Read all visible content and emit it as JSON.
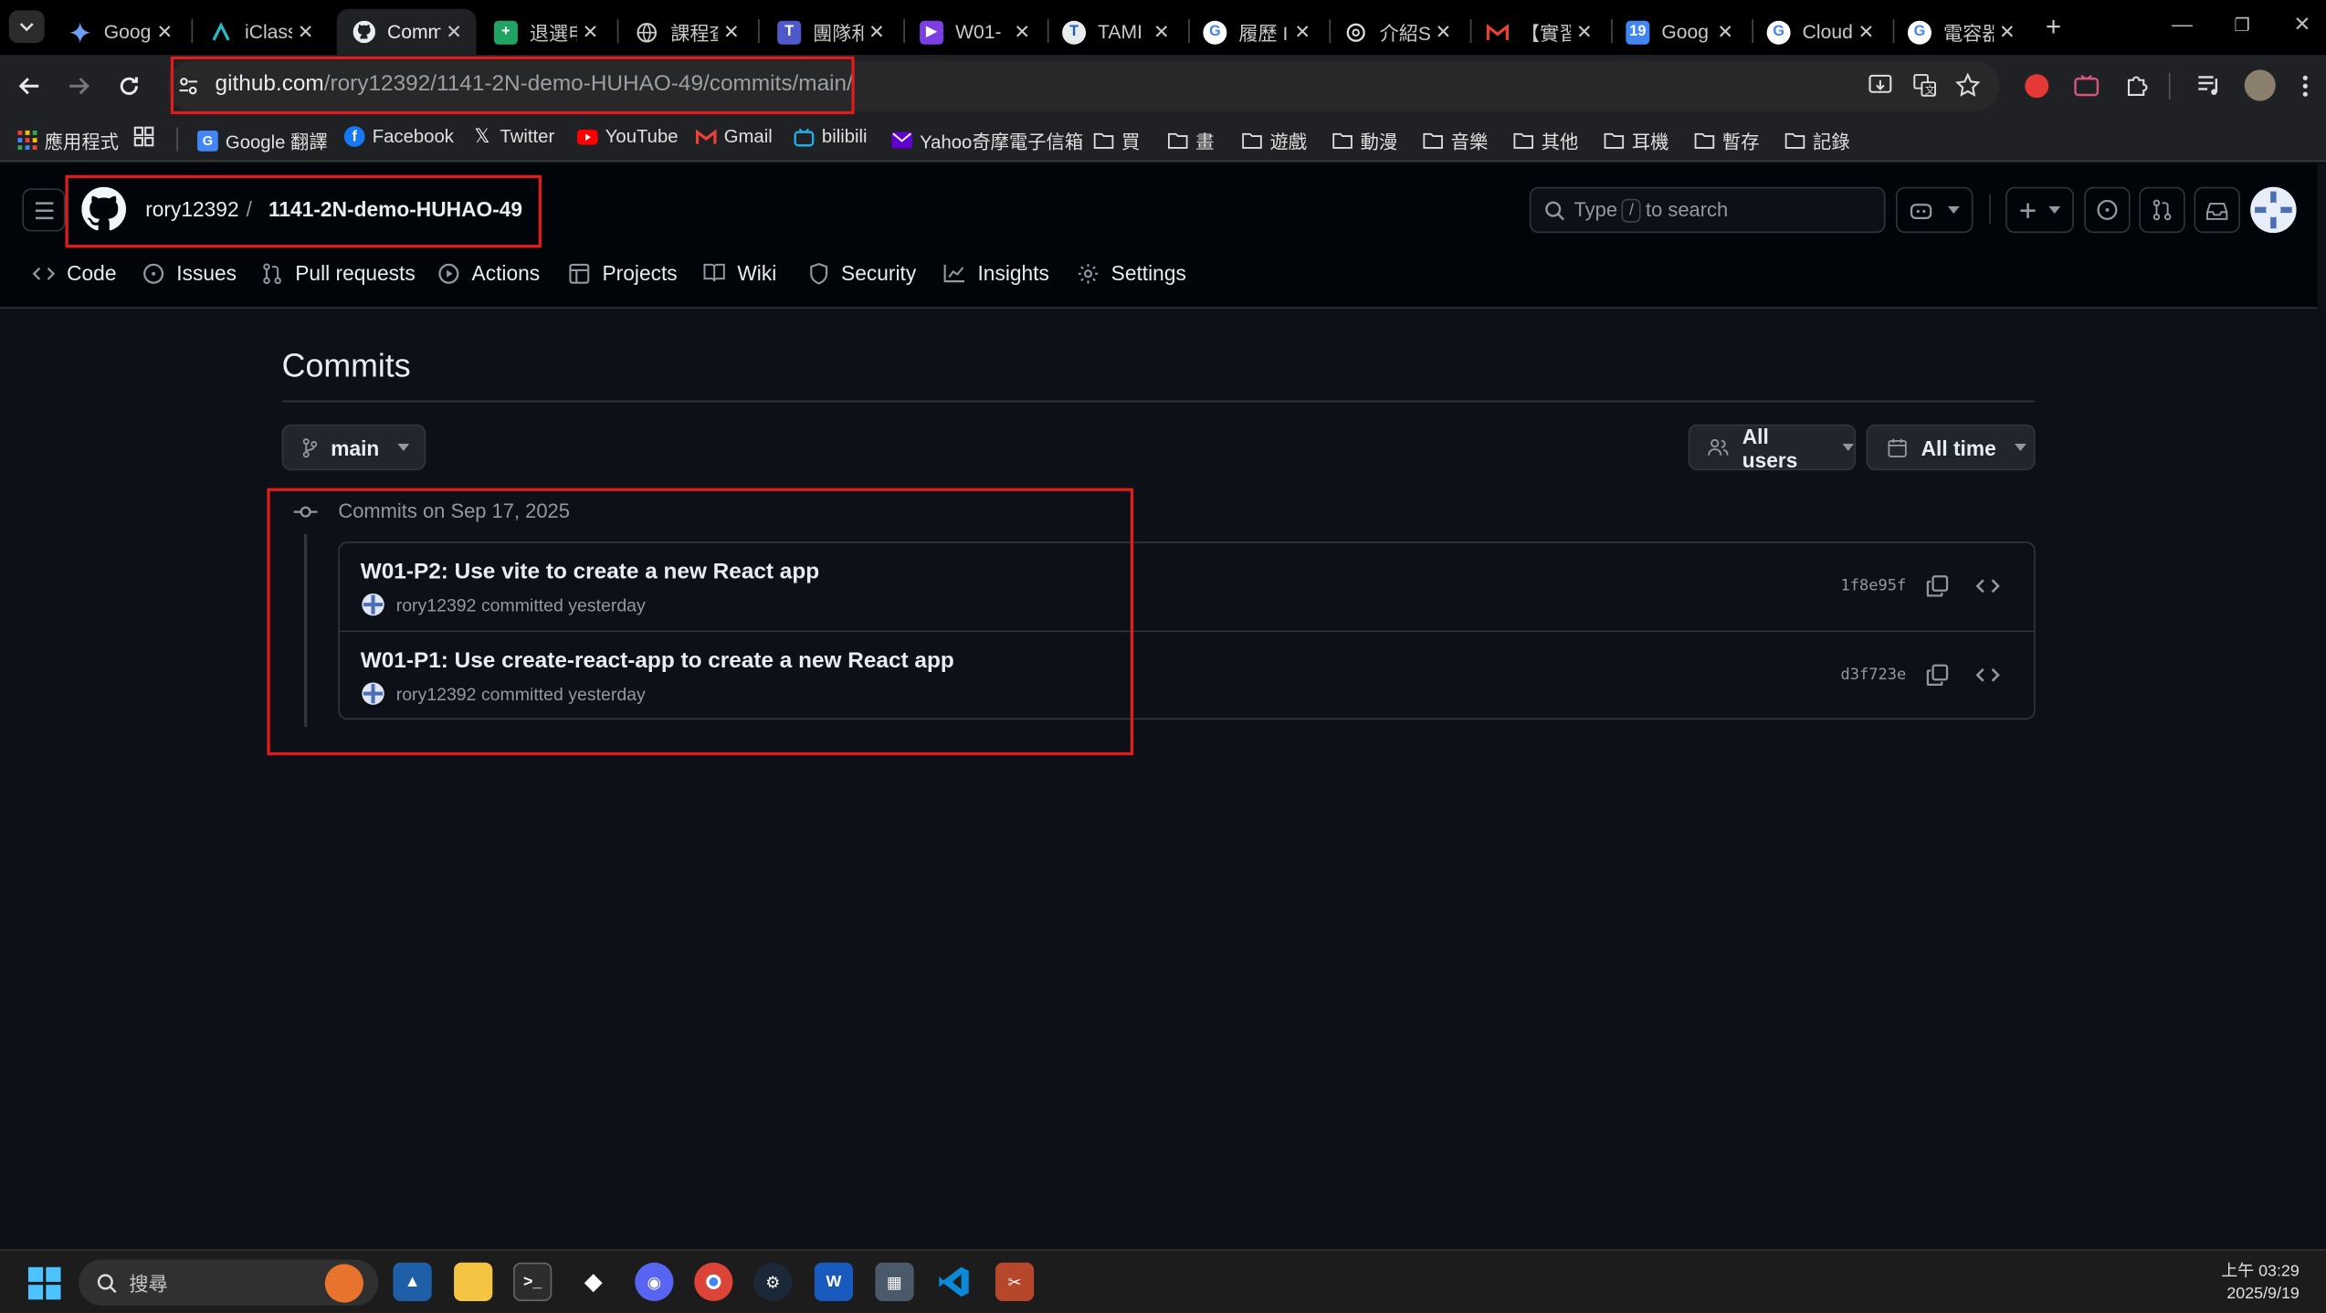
{
  "browser": {
    "tabs": [
      {
        "title": "Goog",
        "icon": "gemini-icon",
        "active": false
      },
      {
        "title": "iClass",
        "icon": "iclass-icon",
        "active": false
      },
      {
        "title": "Comm",
        "icon": "github-icon",
        "active": true
      },
      {
        "title": "退選申",
        "icon": "sheets-icon",
        "active": false
      },
      {
        "title": "課程查",
        "icon": "globe-icon",
        "active": false
      },
      {
        "title": "團隊和",
        "icon": "teams-icon",
        "active": false
      },
      {
        "title": "W01-",
        "icon": "video-icon",
        "active": false
      },
      {
        "title": "TAMI",
        "icon": "tami-icon",
        "active": false
      },
      {
        "title": "履歷 I",
        "icon": "google-icon",
        "active": false
      },
      {
        "title": "介紹S",
        "icon": "openai-icon",
        "active": false
      },
      {
        "title": "【實習",
        "icon": "gmail-icon",
        "active": false
      },
      {
        "title": "Goog",
        "icon": "calendar-icon",
        "active": false
      },
      {
        "title": "Cloud",
        "icon": "google-icon",
        "active": false
      },
      {
        "title": "電容器",
        "icon": "google-icon",
        "active": false
      }
    ],
    "url_host": "github.com",
    "url_path": "/rory12392/1141-2N-demo-HUHAO-49/commits/main/",
    "bookmarks": [
      {
        "label": "應用程式",
        "icon": "apps-grid-icon"
      },
      {
        "label": "",
        "icon": "grid-icon"
      },
      {
        "label": "Google 翻譯",
        "icon": "google-translate-icon"
      },
      {
        "label": "Facebook",
        "icon": "facebook-icon"
      },
      {
        "label": "Twitter",
        "icon": "x-twitter-icon"
      },
      {
        "label": "YouTube",
        "icon": "youtube-icon"
      },
      {
        "label": "Gmail",
        "icon": "gmail-icon"
      },
      {
        "label": "bilibili",
        "icon": "bilibili-icon"
      },
      {
        "label": "Yahoo奇摩電子信箱",
        "icon": "yahoo-mail-icon"
      },
      {
        "label": "買",
        "icon": "folder-icon"
      },
      {
        "label": "畫",
        "icon": "folder-icon"
      },
      {
        "label": "遊戲",
        "icon": "folder-icon"
      },
      {
        "label": "動漫",
        "icon": "folder-icon"
      },
      {
        "label": "音樂",
        "icon": "folder-icon"
      },
      {
        "label": "其他",
        "icon": "folder-icon"
      },
      {
        "label": "耳機",
        "icon": "folder-icon"
      },
      {
        "label": "暫存",
        "icon": "folder-icon"
      },
      {
        "label": "記錄",
        "icon": "folder-icon"
      }
    ]
  },
  "github": {
    "owner": "rory12392",
    "separator": "/",
    "repo": "1141-2N-demo-HUHAO-49",
    "search_prefix": "Type",
    "search_key": "/",
    "search_suffix": "to search",
    "nav": [
      {
        "label": "Code",
        "icon": "code-icon"
      },
      {
        "label": "Issues",
        "icon": "issue-opened-icon"
      },
      {
        "label": "Pull requests",
        "icon": "git-pull-request-icon"
      },
      {
        "label": "Actions",
        "icon": "play-icon"
      },
      {
        "label": "Projects",
        "icon": "table-icon"
      },
      {
        "label": "Wiki",
        "icon": "book-icon"
      },
      {
        "label": "Security",
        "icon": "shield-icon"
      },
      {
        "label": "Insights",
        "icon": "graph-icon"
      },
      {
        "label": "Settings",
        "icon": "gear-icon"
      }
    ]
  },
  "commits_page": {
    "title": "Commits",
    "branch": "main",
    "users_filter": "All users",
    "time_filter": "All time",
    "day_label": "Commits on Sep 17, 2025",
    "commits": [
      {
        "title": "W01-P2: Use vite to create a new React app",
        "author": "rory12392",
        "meta": "committed yesterday",
        "sha": "1f8e95f"
      },
      {
        "title": "W01-P1: Use create-react-app to create a new React app",
        "author": "rory12392",
        "meta": "committed yesterday",
        "sha": "d3f723e"
      }
    ]
  },
  "taskbar": {
    "search_placeholder": "搜尋",
    "time": "上午 03:29",
    "date": "2025/9/19"
  },
  "colors": {
    "page_bg": "#0d1117",
    "header_bg": "#010409",
    "highlight_box": "#e11c1c",
    "border": "#30363d"
  }
}
